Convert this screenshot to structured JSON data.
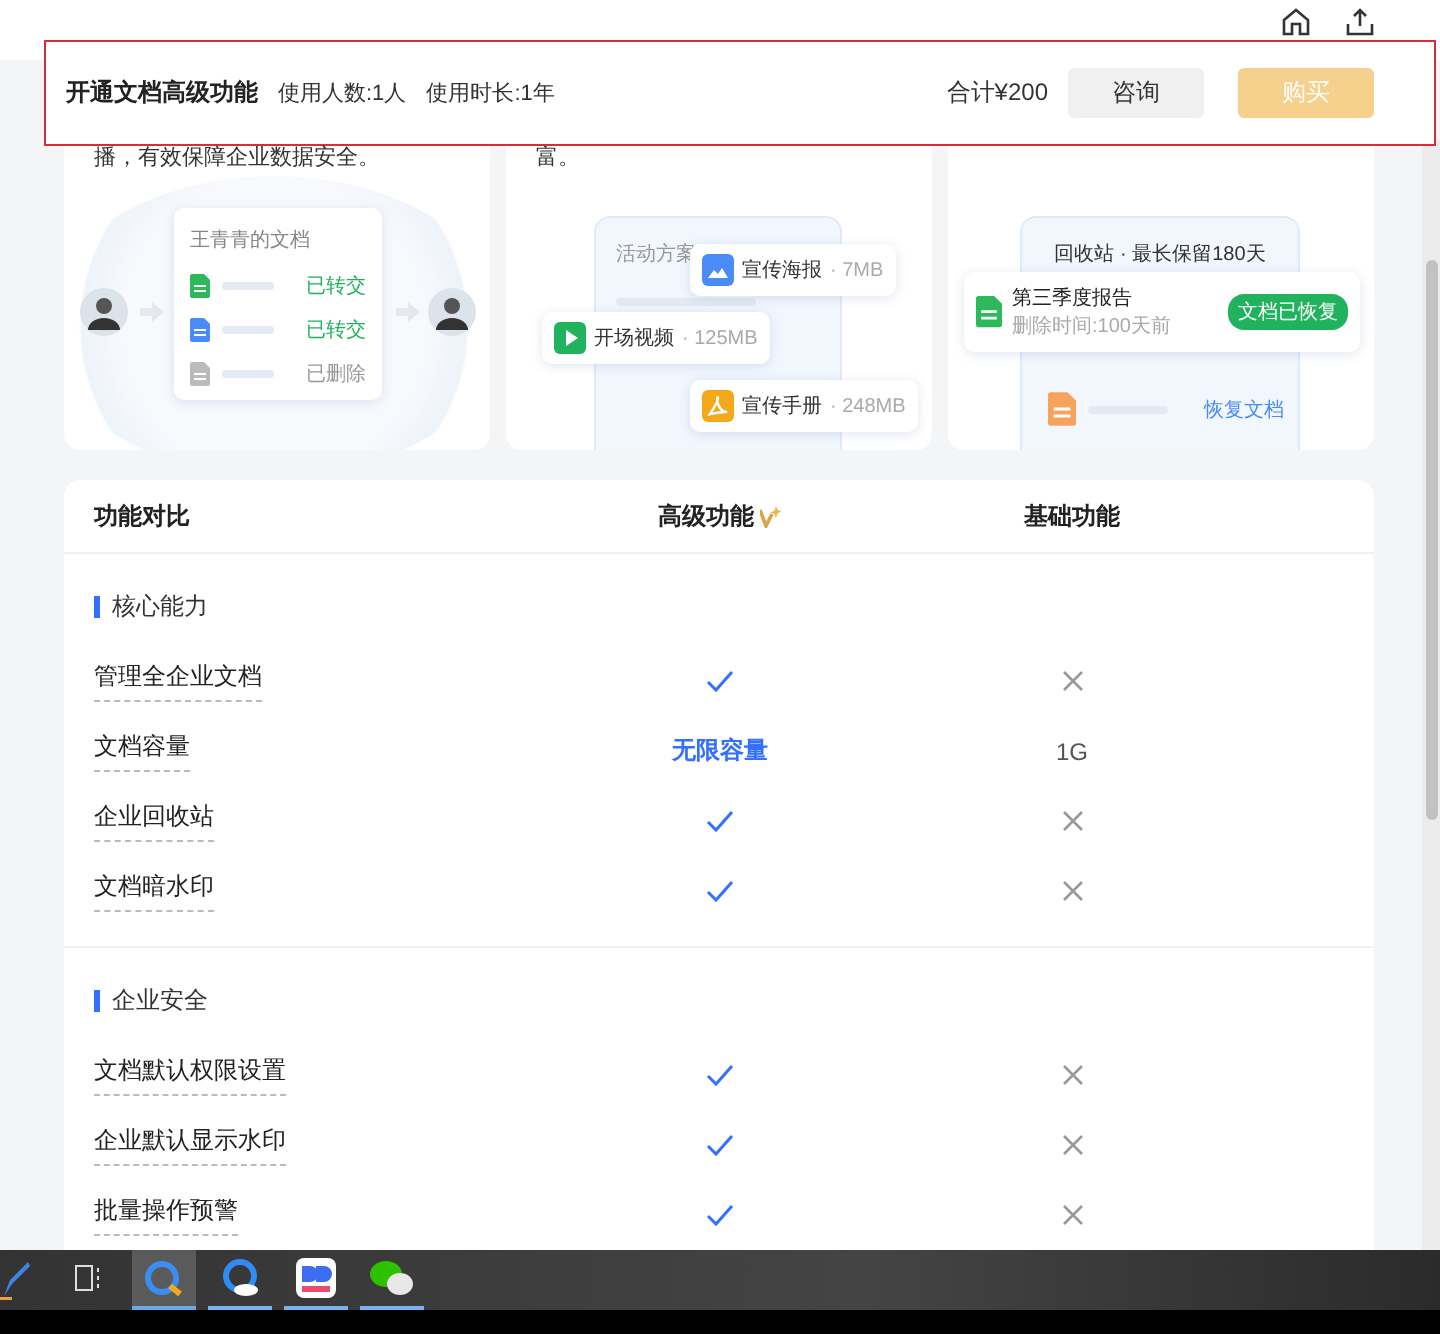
{
  "purchase_bar": {
    "title": "开通文档高级功能",
    "users": "使用人数:1人",
    "duration": "使用时长:1年",
    "total": "合计¥200",
    "buttons": [
      {
        "label": "咨询",
        "kind": "secondary"
      },
      {
        "label": "购买",
        "kind": "primary"
      }
    ]
  },
  "feature_cards": [
    {
      "kind": "transfer",
      "description": "播，有效保障企业数据安全。",
      "doc_title": "王青青的文档",
      "items": [
        {
          "kind": "sheet",
          "status": "已转交",
          "done": true
        },
        {
          "kind": "doc",
          "status": "已转交",
          "done": true
        },
        {
          "kind": "file",
          "status": "已删除",
          "done": false
        }
      ]
    },
    {
      "kind": "media",
      "description": "富。",
      "panel_title": "活动方案",
      "items": [
        {
          "kind": "image",
          "name": "宣传海报",
          "size": "· 7MB"
        },
        {
          "kind": "video",
          "name": "开场视频",
          "size": "· 125MB"
        },
        {
          "kind": "pdf",
          "name": "宣传手册",
          "size": "· 248MB"
        }
      ]
    },
    {
      "kind": "recycle",
      "panel_title": "回收站 · 最长保留180天",
      "report": "第三季度报告",
      "deleted": "删除时间:100天前",
      "badge": "文档已恢复",
      "restore": "恢复文档"
    }
  ],
  "comparison": {
    "columns": [
      "功能对比",
      "高级功能",
      "基础功能"
    ],
    "sections": [
      {
        "title": "核心能力",
        "rows": [
          {
            "feature": "管理全企业文档",
            "premium": {
              "kind": "check"
            },
            "basic": {
              "kind": "cross"
            }
          },
          {
            "feature": "文档容量",
            "premium": {
              "kind": "text",
              "text": "无限容量"
            },
            "basic": {
              "kind": "text",
              "text": "1G"
            }
          },
          {
            "feature": "企业回收站",
            "premium": {
              "kind": "check"
            },
            "basic": {
              "kind": "cross"
            }
          },
          {
            "feature": "文档暗水印",
            "premium": {
              "kind": "check"
            },
            "basic": {
              "kind": "cross"
            }
          }
        ]
      },
      {
        "title": "企业安全",
        "rows": [
          {
            "feature": "文档默认权限设置",
            "premium": {
              "kind": "check"
            },
            "basic": {
              "kind": "cross"
            }
          },
          {
            "feature": "企业默认显示水印",
            "premium": {
              "kind": "check"
            },
            "basic": {
              "kind": "cross"
            }
          },
          {
            "feature": "批量操作预警",
            "premium": {
              "kind": "check"
            },
            "basic": {
              "kind": "cross"
            }
          }
        ]
      }
    ]
  },
  "taskbar": {
    "apps": [
      {
        "kind": "browser",
        "selected": true
      },
      {
        "kind": "cloud",
        "selected": false
      },
      {
        "kind": "dd",
        "selected": false
      },
      {
        "kind": "chat",
        "selected": false
      }
    ]
  }
}
